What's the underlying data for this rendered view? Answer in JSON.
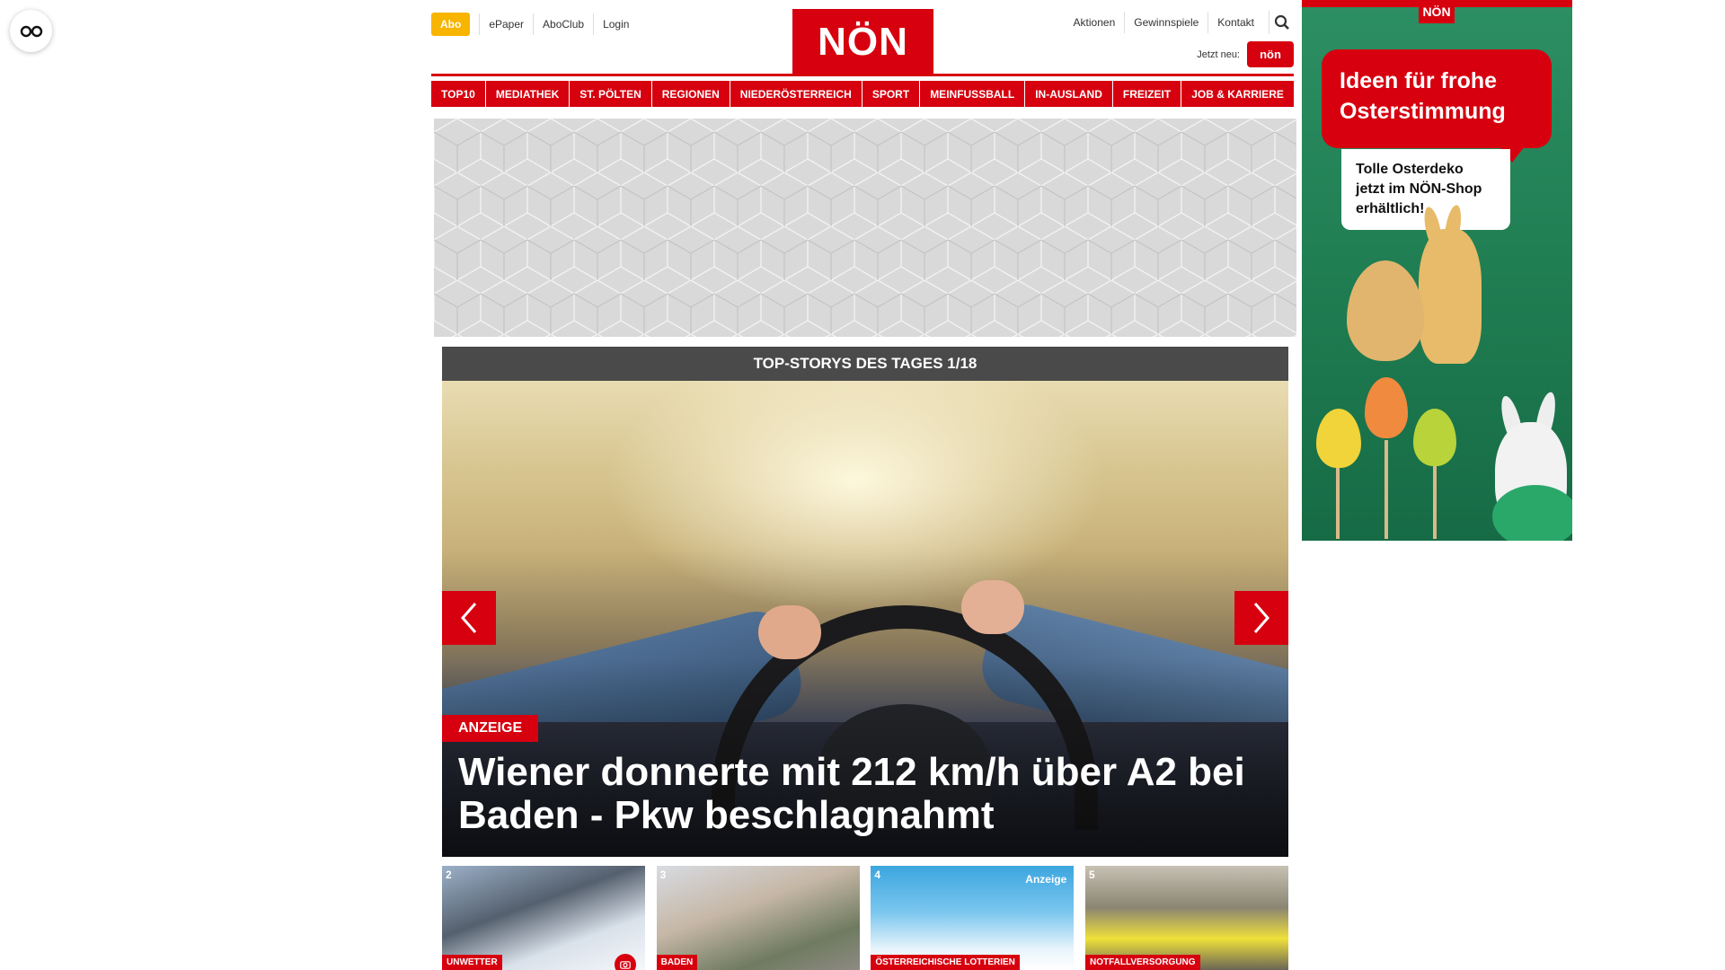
{
  "header": {
    "abo_label": "Abo",
    "top_links": [
      "ePaper",
      "AboClub",
      "Login"
    ],
    "logo_text": "NÖN",
    "right_links": [
      "Aktionen",
      "Gewinnspiele",
      "Kontakt"
    ],
    "jetzt_neu_label": "Jetzt neu:",
    "jetzt_neu_badge": "nön"
  },
  "nav": {
    "items": [
      "TOP10",
      "MEDIATHEK",
      "ST. PÖLTEN",
      "REGIONEN",
      "NIEDERÖSTERREICH",
      "SPORT",
      "MEINFUSSBALL",
      "IN-AUSLAND",
      "FREIZEIT",
      "JOB & KARRIERE"
    ]
  },
  "stories": {
    "title": "TOP-STORYS DES TAGES 1/18",
    "hero": {
      "tag": "ANZEIGE",
      "headline": "Wiener donnerte mit 212 km/h über A2 bei Baden - Pkw beschlagnahmt"
    },
    "thumbs": [
      {
        "num": "2",
        "category": "UNWETTER",
        "ad": ""
      },
      {
        "num": "3",
        "category": "BADEN",
        "ad": ""
      },
      {
        "num": "4",
        "category": "ÖSTERREICHISCHE LOTTERIEN",
        "ad": "Anzeige"
      },
      {
        "num": "5",
        "category": "NOTFALLVERSORGUNG",
        "ad": ""
      }
    ]
  },
  "side_ad": {
    "logo": "NÖN",
    "headline": "Ideen für frohe Osterstimmung",
    "note": "Tolle Osterdeko jetzt im NÖN-Shop erhältlich!"
  },
  "colors": {
    "brand_red": "#d6000f",
    "abo_yellow": "#f7b500",
    "ad_green": "#1f7c51"
  },
  "icons": [
    "accessibility-glasses-icon",
    "search-icon",
    "chevron-left-icon",
    "chevron-right-icon",
    "camera-icon"
  ]
}
